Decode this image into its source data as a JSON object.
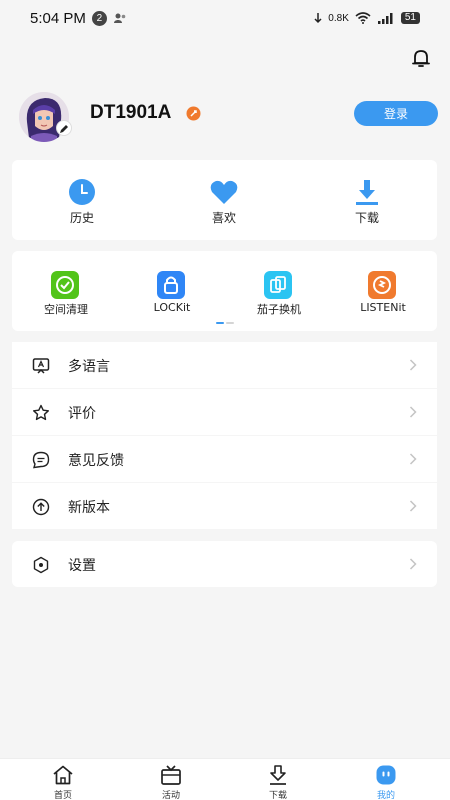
{
  "status_bar": {
    "time": "5:04 PM",
    "notif_count": "2",
    "net_speed": "0.8K",
    "battery": "51"
  },
  "profile": {
    "username": "DT1901A",
    "login_label": "登录"
  },
  "quick_actions": [
    {
      "label": "历史",
      "icon": "clock-icon"
    },
    {
      "label": "喜欢",
      "icon": "heart-icon"
    },
    {
      "label": "下载",
      "icon": "download-icon"
    }
  ],
  "apps": [
    {
      "label": "空间清理",
      "icon": "space-clean-icon",
      "color": "#52c41a"
    },
    {
      "label": "LOCKit",
      "icon": "lock-icon",
      "color": "#2f86f6"
    },
    {
      "label": "茄子换机",
      "icon": "phone-transfer-icon",
      "color": "#2bc4f2"
    },
    {
      "label": "LISTENit",
      "icon": "music-icon",
      "color": "#f07a2e"
    }
  ],
  "menu": [
    {
      "label": "多语言",
      "icon": "language-icon"
    },
    {
      "label": "评价",
      "icon": "star-icon"
    },
    {
      "label": "意见反馈",
      "icon": "feedback-icon"
    },
    {
      "label": "新版本",
      "icon": "upgrade-icon"
    }
  ],
  "settings_label": "设置",
  "bottom_nav": [
    {
      "label": "首页",
      "icon": "home-icon"
    },
    {
      "label": "活动",
      "icon": "tv-icon"
    },
    {
      "label": "下载",
      "icon": "download-icon"
    },
    {
      "label": "我的",
      "icon": "profile-icon"
    }
  ],
  "colors": {
    "accent": "#3b99f0",
    "background": "#f5f5f5"
  }
}
